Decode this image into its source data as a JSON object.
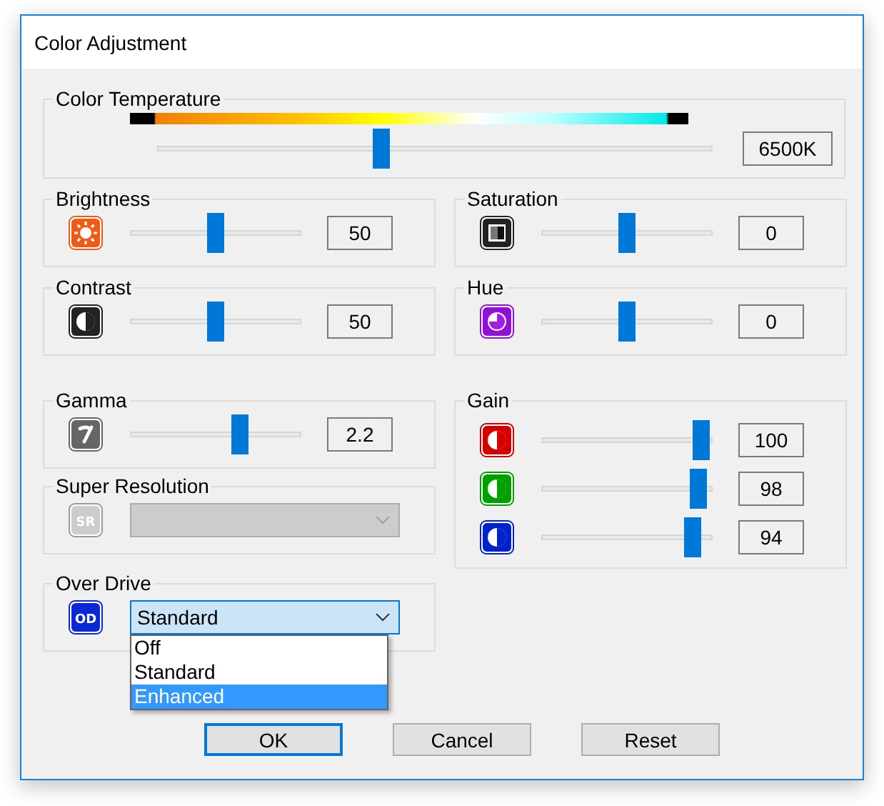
{
  "window": {
    "title": "Color Adjustment"
  },
  "color_temperature": {
    "label": "Color Temperature",
    "level": 0.4,
    "value": "6500K"
  },
  "left": [
    {
      "kind": "slider",
      "label": "Brightness",
      "level": 0.5,
      "value": "50"
    },
    {
      "kind": "slider",
      "label": "Contrast",
      "level": 0.5,
      "value": "50"
    },
    {
      "kind": "slider",
      "label": "Gamma",
      "level": 0.66,
      "value": "2.2"
    },
    {
      "kind": "dropdown",
      "label": "Super Resolution",
      "badge": "SR",
      "disabled": true,
      "expanded": false
    },
    {
      "kind": "dropdown",
      "label": "Over Drive",
      "badge": "OD",
      "disabled": false,
      "expanded": true,
      "value": "Standard",
      "options": [
        {
          "label": "Off",
          "highlighted": false
        },
        {
          "label": "Standard",
          "highlighted": false
        },
        {
          "label": "Enhanced",
          "highlighted": true
        }
      ]
    }
  ],
  "right": [
    {
      "kind": "slider",
      "label": "Saturation",
      "level": 0.5,
      "value": "0"
    },
    {
      "kind": "slider",
      "label": "Hue",
      "level": 0.5,
      "value": "0"
    },
    {
      "kind": "multi",
      "label": "Gain",
      "channels": [
        {
          "color": "#d40000",
          "level": 0.98,
          "value": "100"
        },
        {
          "color": "#00a000",
          "level": 0.96,
          "value": "98"
        },
        {
          "color": "#0022cc",
          "level": 0.93,
          "value": "94"
        }
      ]
    }
  ],
  "buttons": [
    {
      "label": "OK",
      "default": true
    },
    {
      "label": "Cancel",
      "default": false
    },
    {
      "label": "Reset",
      "default": false
    }
  ]
}
